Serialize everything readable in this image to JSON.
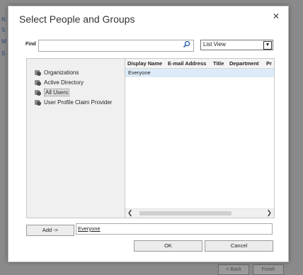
{
  "background": {
    "side_letters": [
      "N",
      "S",
      "M",
      "S"
    ],
    "back_label": "< Back",
    "finish_label": "Finish"
  },
  "dialog": {
    "title": "Select People and Groups",
    "close_glyph": "✕"
  },
  "find": {
    "label": "Find",
    "value": "",
    "search_icon": "search-icon"
  },
  "view": {
    "selected": "List View"
  },
  "tree": {
    "items": [
      {
        "label": "Organizations",
        "icon": "directory-icon",
        "selected": false
      },
      {
        "label": "Active Directory",
        "icon": "directory-icon",
        "selected": false
      },
      {
        "label": "All Users",
        "icon": "directory-icon",
        "selected": true
      },
      {
        "label": "User Profile Claim Provider",
        "icon": "directory-icon",
        "selected": false
      }
    ]
  },
  "results": {
    "columns": [
      "Display Name",
      "E-mail Address",
      "Title",
      "Department",
      "Pr"
    ],
    "rows": [
      {
        "display_name": "Everyone"
      }
    ]
  },
  "add": {
    "button_label": "Add ->",
    "value": "Everyone"
  },
  "actions": {
    "ok_label": "OK",
    "cancel_label": "Cancel"
  },
  "colors": {
    "selected_row": "#dcebf7",
    "search_icon": "#1f5fae"
  }
}
